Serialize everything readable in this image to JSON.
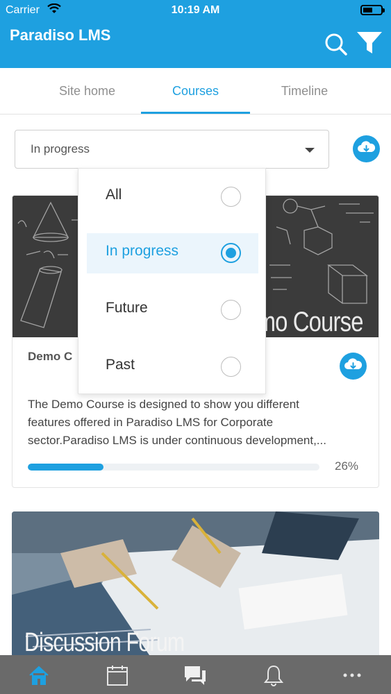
{
  "status_bar": {
    "carrier": "Carrier",
    "time": "10:19 AM"
  },
  "app": {
    "title": "Paradiso LMS",
    "accent_color": "#1ea0e0"
  },
  "header_actions": {
    "search_icon": "search-icon",
    "filter_icon": "filter-icon"
  },
  "tabs": [
    {
      "label": "Site home"
    },
    {
      "label": "Courses"
    },
    {
      "label": "Timeline"
    }
  ],
  "active_tab": "Courses",
  "filter": {
    "selected": "In progress"
  },
  "filter_options": [
    {
      "label": "All"
    },
    {
      "label": "In progress"
    },
    {
      "label": "Future"
    },
    {
      "label": "Past"
    }
  ],
  "selected_option": "In progress",
  "courses": [
    {
      "image_title": "mo Course",
      "name": "Demo C",
      "description_lines": [
        "The Demo Course is designed to show you different",
        "features offered in Paradiso LMS for Corporate",
        "sector.Paradiso LMS is under continuous development,..."
      ],
      "progress_percent": 26,
      "progress_label": "26%"
    },
    {
      "image_title": "Discussion Forum"
    }
  ],
  "bottom_nav": [
    {
      "icon": "home-icon",
      "active": true
    },
    {
      "icon": "calendar-icon"
    },
    {
      "icon": "messages-icon"
    },
    {
      "icon": "bell-icon"
    },
    {
      "icon": "more-icon"
    }
  ]
}
